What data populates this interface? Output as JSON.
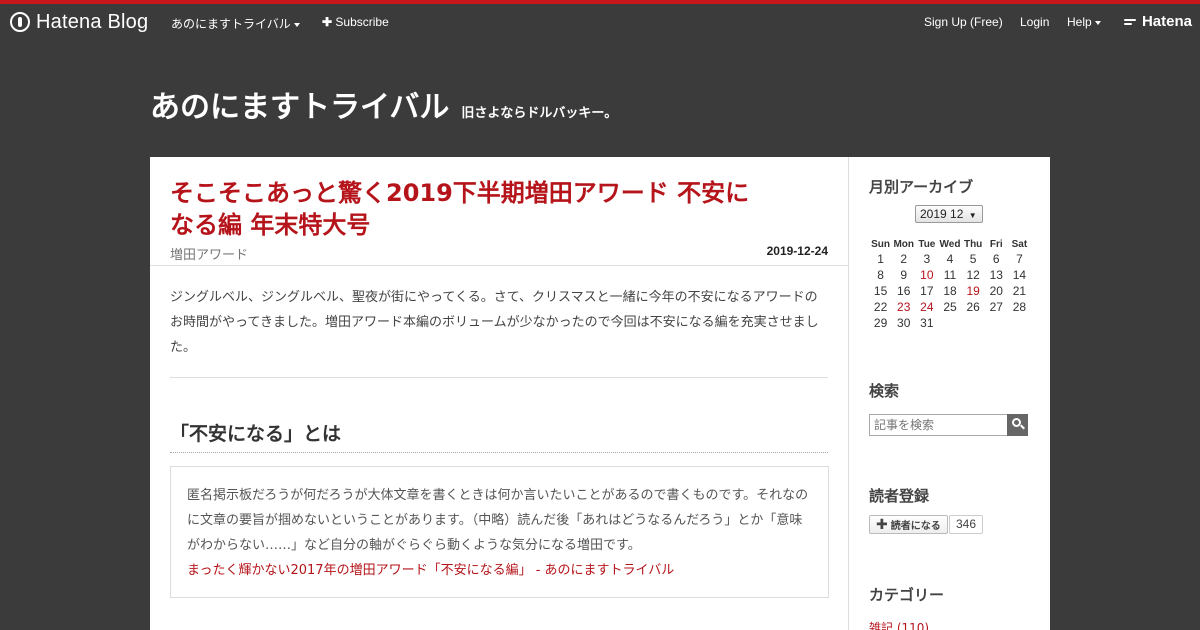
{
  "global_header": {
    "logo_text": "Hatena Blog",
    "blog_menu_label": "あのにますトライバル",
    "subscribe_label": "Subscribe",
    "signup_label": "Sign Up (Free)",
    "login_label": "Login",
    "help_label": "Help",
    "hatena_label": "Hatena",
    "accent_color": "#c8161d"
  },
  "blog": {
    "title": "あのにますトライバル",
    "description": "旧さよならドルバッキー。"
  },
  "entry": {
    "title": "そこそこあっと驚く2019下半期増田アワード 不安になる編 年末特大号",
    "category": "増田アワード",
    "date": "2019-12-24",
    "intro": "ジングルベル、ジングルベル、聖夜が街にやってくる。さて、クリスマスと一緒に今年の不安になるアワードのお時間がやってきました。増田アワード本編のボリュームが少なかったので今回は不安になる編を充実させました。",
    "section_heading": "「不安になる」とは",
    "quote_text": "匿名掲示板だろうが何だろうが大体文章を書くときは何か言いたいことがあるので書くものです。それなのに文章の要旨が掴めないということがあります。（中略）読んだ後「あれはどうなるんだろう」とか「意味がわからない……」など自分の軸がぐらぐら動くような気分になる増田です。",
    "quote_cite": "まったく輝かない2017年の増田アワード「不安になる編」 - あのにますトライバル"
  },
  "sidebar": {
    "archive": {
      "title": "月別アーカイブ",
      "selected_month": "2019 12",
      "weekdays": [
        "Sun",
        "Mon",
        "Tue",
        "Wed",
        "Thu",
        "Fri",
        "Sat"
      ],
      "weeks": [
        [
          "1",
          "2",
          "3",
          "4",
          "5",
          "6",
          "7"
        ],
        [
          "8",
          "9",
          "10",
          "11",
          "12",
          "13",
          "14"
        ],
        [
          "15",
          "16",
          "17",
          "18",
          "19",
          "20",
          "21"
        ],
        [
          "22",
          "23",
          "24",
          "25",
          "26",
          "27",
          "28"
        ],
        [
          "29",
          "30",
          "31",
          "",
          "",
          "",
          ""
        ]
      ],
      "linked_days": [
        "10",
        "19",
        "23",
        "24"
      ]
    },
    "search": {
      "title": "検索",
      "placeholder": "記事を検索"
    },
    "subscribe": {
      "title": "読者登録",
      "button_label": "読者になる",
      "count": "346"
    },
    "categories": {
      "title": "カテゴリー",
      "first_item": "雑記 (110)"
    }
  }
}
